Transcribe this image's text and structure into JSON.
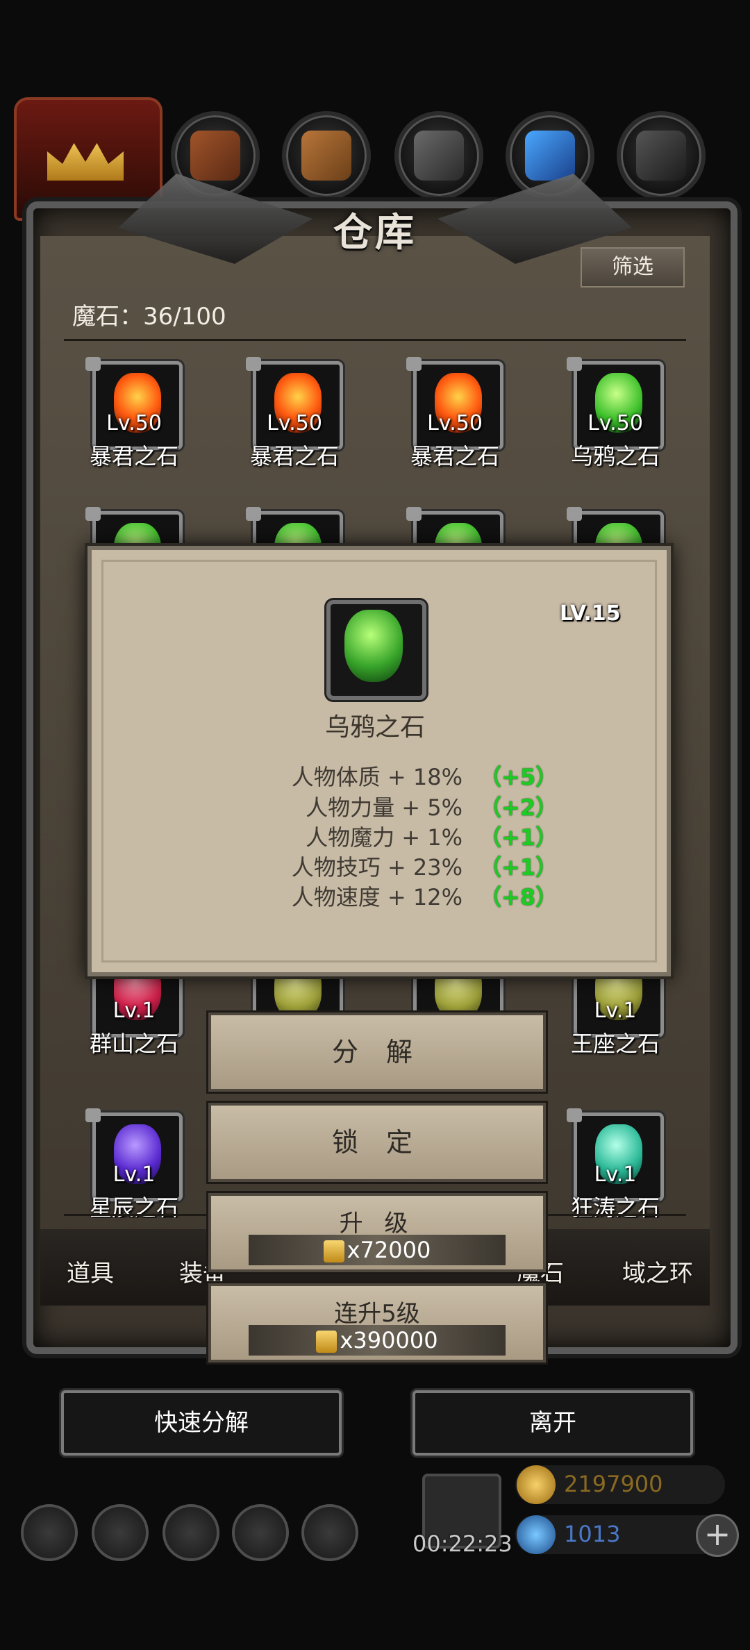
{
  "panel": {
    "title": "仓库",
    "filter_label": "筛选",
    "count_label": "魔石：36/100"
  },
  "items": [
    {
      "level": "Lv.50",
      "name": "暴君之石",
      "gem_color": "#ff7a1a"
    },
    {
      "level": "Lv.50",
      "name": "暴君之石",
      "gem_color": "#ff7a1a"
    },
    {
      "level": "Lv.50",
      "name": "暴君之石",
      "gem_color": "#ff7a1a"
    },
    {
      "level": "Lv.50",
      "name": "乌鸦之石",
      "gem_color": "#7dff4a"
    },
    {
      "level": "Lv.1",
      "name": "群山之石",
      "gem_color": "#e0305a"
    },
    {
      "level": "Lv.1",
      "name": "王座之石",
      "gem_color": "#d8e07a"
    },
    {
      "level": "Lv.1",
      "name": "星辰之石",
      "gem_color": "#7a4ad8"
    },
    {
      "level": "Lv.1",
      "name": "狂涛之石",
      "gem_color": "#5ae0c0"
    }
  ],
  "tabs": [
    "道具",
    "装备",
    "魔石",
    "域之环"
  ],
  "popup": {
    "level": "LV.15",
    "name": "乌鸦之石",
    "stats": [
      {
        "text": "人物体质 + 18%",
        "bonus": "（+5）"
      },
      {
        "text": "人物力量 + 5%",
        "bonus": "（+2）"
      },
      {
        "text": "人物魔力 + 1%",
        "bonus": "（+1）"
      },
      {
        "text": "人物技巧 + 23%",
        "bonus": "（+1）"
      },
      {
        "text": "人物速度 + 12%",
        "bonus": "（+8）"
      }
    ]
  },
  "actions": {
    "decompose": "分 解",
    "lock": "锁 定",
    "upgrade": "升 级",
    "upgrade_cost": "x72000",
    "upgrade5": "连升5级",
    "upgrade5_cost": "x390000"
  },
  "bottom": {
    "quick_decompose": "快速分解",
    "leave": "离开",
    "timer": "00:22:23",
    "gold": "2197900",
    "gems": "1013",
    "plus": "+"
  }
}
